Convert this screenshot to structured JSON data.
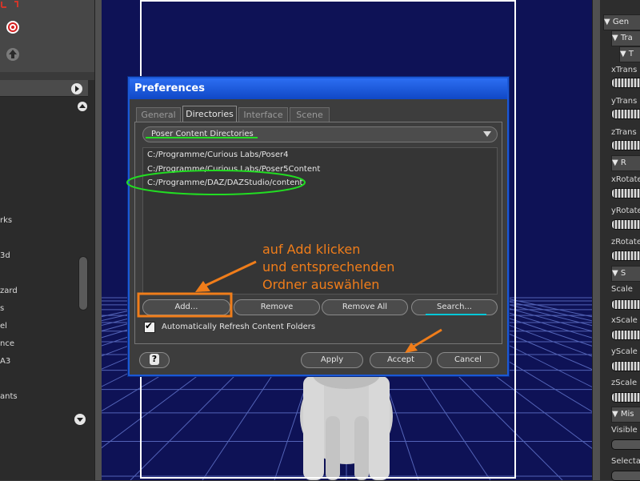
{
  "left_panel": {
    "labels": [
      "rks",
      "3d",
      "zard",
      "s",
      "el",
      "nce",
      "A3",
      "ants"
    ]
  },
  "dialog": {
    "title": "Preferences",
    "tabs": [
      {
        "label": "General",
        "active": false
      },
      {
        "label": "Directories",
        "active": true
      },
      {
        "label": "Interface",
        "active": false
      },
      {
        "label": "Scene",
        "active": false
      }
    ],
    "dropdown": {
      "selected": "Poser Content Directories"
    },
    "directories": [
      "C:/Programme/Curious Labs/Poser4",
      "C:/Programme/Curious Labs/Poser5Content",
      "C:/Programme/DAZ/DAZStudio/content"
    ],
    "buttons": {
      "add": "Add...",
      "remove": "Remove",
      "remove_all": "Remove All",
      "search": "Search...",
      "apply": "Apply",
      "accept": "Accept",
      "cancel": "Cancel"
    },
    "checkbox": {
      "label": "Automatically Refresh Content Folders",
      "checked": true
    },
    "help_symbol": "?"
  },
  "annotation": {
    "line1": "auf Add klicken",
    "line2": "und entsprechenden",
    "line3": "Ordner auswählen",
    "color": "#f07d1a"
  },
  "right_panel": {
    "headers": [
      "Gen",
      "Tra",
      "T",
      "R",
      "S",
      "Mis"
    ],
    "labels": [
      "xTrans",
      "yTrans",
      "zTrans",
      "xRotate",
      "yRotate",
      "zRotate",
      "Scale",
      "xScale",
      "yScale",
      "zScale",
      "Visible",
      "Selecta"
    ]
  },
  "colors": {
    "viewport": "#0e1256",
    "dialog_border": "#1b58d6",
    "highlight_green": "#22dd22",
    "highlight_cyan": "#00c8d8",
    "highlight_orange": "#f07d1a"
  }
}
